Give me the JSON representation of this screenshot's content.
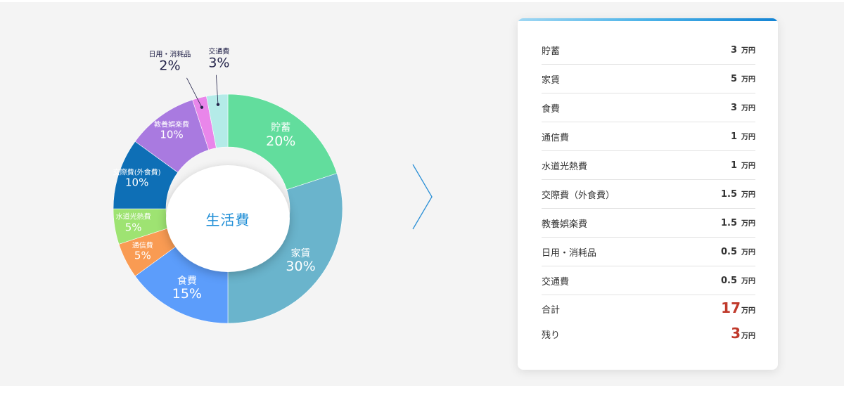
{
  "chart_data": {
    "type": "pie",
    "center_label": "生活費",
    "slices": [
      {
        "name": "貯蓄",
        "percent_label": "20%",
        "value": 20,
        "color": "#62dd9d"
      },
      {
        "name": "家賃",
        "percent_label": "30%",
        "value": 30,
        "color": "#6ab4cc"
      },
      {
        "name": "食費",
        "percent_label": "15%",
        "value": 15,
        "color": "#5c9dfb"
      },
      {
        "name": "通信費",
        "percent_label": "5%",
        "value": 5,
        "color": "#f99b53"
      },
      {
        "name": "水道光熱費",
        "percent_label": "5%",
        "value": 5,
        "color": "#9ee372"
      },
      {
        "name": "交際費(外食費)",
        "percent_label": "10%",
        "value": 10,
        "color": "#0e6fb6"
      },
      {
        "name": "教養娯楽費",
        "percent_label": "10%",
        "value": 10,
        "color": "#a97ae0"
      },
      {
        "name": "日用・消耗品",
        "percent_label": "2%",
        "value": 2,
        "color": "#e986ea"
      },
      {
        "name": "交通費",
        "percent_label": "3%",
        "value": 3,
        "color": "#b4ebe8"
      }
    ]
  },
  "panel": {
    "accent_color": "#1484d4",
    "unit": "万円",
    "items": [
      {
        "label": "貯蓄",
        "value": "3"
      },
      {
        "label": "家賃",
        "value": "5"
      },
      {
        "label": "食費",
        "value": "3"
      },
      {
        "label": "通信費",
        "value": "1"
      },
      {
        "label": "水道光熱費",
        "value": "1"
      },
      {
        "label": "交際費（外食費）",
        "value": "1.5"
      },
      {
        "label": "教養娯楽費",
        "value": "1.5"
      },
      {
        "label": "日用・消耗品",
        "value": "0.5"
      },
      {
        "label": "交通費",
        "value": "0.5"
      }
    ],
    "total": {
      "label": "合計",
      "value": "17",
      "color": "#c0392b"
    },
    "remaining": {
      "label": "残り",
      "value": "3",
      "color": "#c0392b"
    }
  }
}
